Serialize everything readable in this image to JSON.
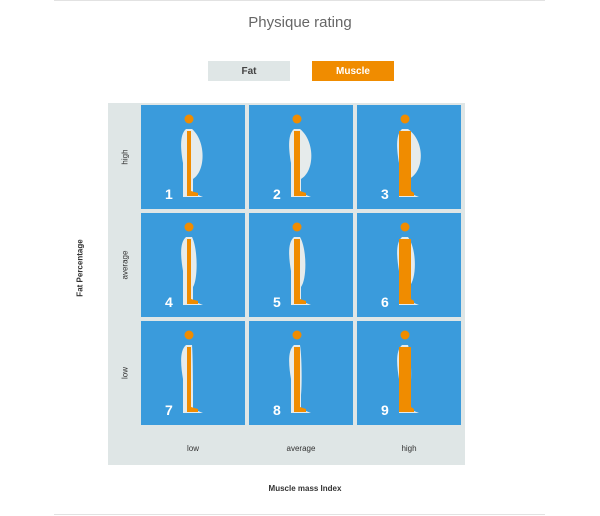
{
  "title": "Physique rating",
  "legend": [
    {
      "label": "Fat",
      "color": "#dfe6e6"
    },
    {
      "label": "Muscle",
      "color": "#f08c00"
    }
  ],
  "colors": {
    "cell": "#3a9bdc",
    "frame": "#dfe6e6",
    "muscle": "#f08c00",
    "fat": "#e6ebeb"
  },
  "x_axis": {
    "title": "Muscle mass Index",
    "labels": [
      "low",
      "average",
      "high"
    ]
  },
  "y_axis": {
    "title": "Fat Percentage",
    "labels": [
      "high",
      "average",
      "low"
    ]
  },
  "cells": [
    {
      "number": "1",
      "fat": "high",
      "muscle": "low"
    },
    {
      "number": "2",
      "fat": "high",
      "muscle": "average"
    },
    {
      "number": "3",
      "fat": "high",
      "muscle": "high"
    },
    {
      "number": "4",
      "fat": "average",
      "muscle": "low"
    },
    {
      "number": "5",
      "fat": "average",
      "muscle": "average"
    },
    {
      "number": "6",
      "fat": "average",
      "muscle": "high"
    },
    {
      "number": "7",
      "fat": "low",
      "muscle": "low"
    },
    {
      "number": "8",
      "fat": "low",
      "muscle": "average"
    },
    {
      "number": "9",
      "fat": "low",
      "muscle": "high"
    }
  ]
}
